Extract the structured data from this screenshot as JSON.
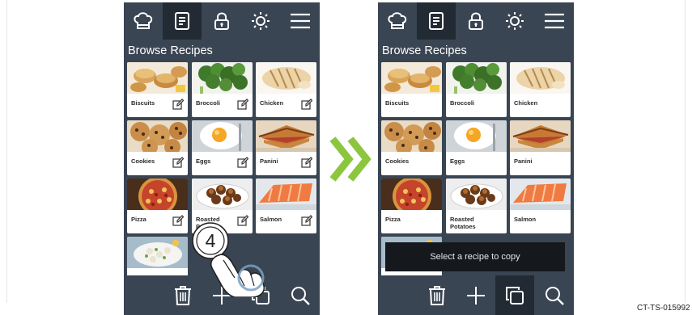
{
  "screens": [
    {
      "id": "before",
      "title": "Browse Recipes",
      "active_tab": "recipes",
      "active_bottom": "none",
      "show_edit_icons": true,
      "toast": "",
      "recipes": [
        {
          "label": "Biscuits",
          "photo": "biscuits"
        },
        {
          "label": "Broccoli",
          "photo": "broccoli"
        },
        {
          "label": "Chicken",
          "photo": "chicken"
        },
        {
          "label": "Cookies",
          "photo": "cookies"
        },
        {
          "label": "Eggs",
          "photo": "eggs"
        },
        {
          "label": "Panini",
          "photo": "panini"
        },
        {
          "label": "Pizza",
          "photo": "pizza"
        },
        {
          "label": "Roasted Potatoes",
          "photo": "potatoes"
        },
        {
          "label": "Salmon",
          "photo": "salmon"
        },
        {
          "label": "",
          "photo": "salad"
        }
      ]
    },
    {
      "id": "after",
      "title": "Browse Recipes",
      "active_tab": "recipes",
      "active_bottom": "copy",
      "show_edit_icons": false,
      "toast": "Select a recipe to copy",
      "recipes": [
        {
          "label": "Biscuits",
          "photo": "biscuits"
        },
        {
          "label": "Broccoli",
          "photo": "broccoli"
        },
        {
          "label": "Chicken",
          "photo": "chicken"
        },
        {
          "label": "Cookies",
          "photo": "cookies"
        },
        {
          "label": "Eggs",
          "photo": "eggs"
        },
        {
          "label": "Panini",
          "photo": "panini"
        },
        {
          "label": "Pizza",
          "photo": "pizza"
        },
        {
          "label": "Roasted Potatoes",
          "photo": "potatoes"
        },
        {
          "label": "Salmon",
          "photo": "salmon"
        },
        {
          "label": "",
          "photo": "salad"
        }
      ]
    }
  ],
  "top_tabs": [
    "chef-hat-icon",
    "recipe-book-icon",
    "lock-icon",
    "brightness-icon",
    "menu-icon"
  ],
  "bottom_buttons": [
    "trash-icon",
    "plus-icon",
    "copy-icon",
    "search-icon"
  ],
  "step_number": "4",
  "figure_code": "CT-TS-015992",
  "colors": {
    "bar": "#3a4553",
    "active": "#222a33",
    "arrow": "#8cc63f",
    "toast": "#15191e"
  }
}
